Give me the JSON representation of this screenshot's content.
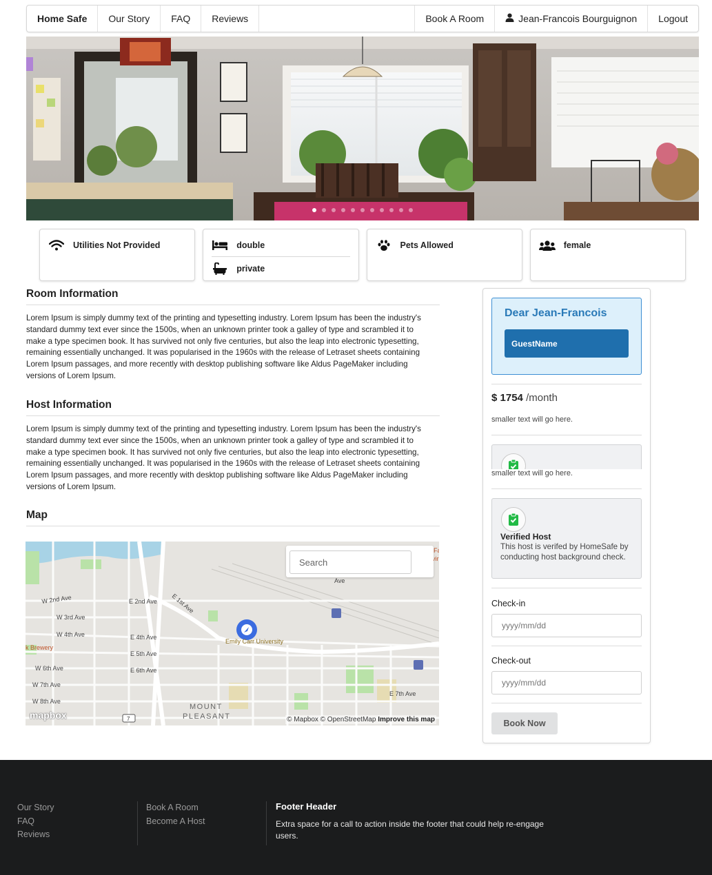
{
  "nav": {
    "brand": "Home Safe",
    "left_items": [
      "Our Story",
      "FAQ",
      "Reviews"
    ],
    "book_room": "Book A Room",
    "user_name": "Jean-Francois Bourguignon",
    "logout": "Logout"
  },
  "hero": {
    "slide_count": 11,
    "active_slide": 0
  },
  "features": {
    "utilities": "Utilities Not Provided",
    "bed": "double",
    "bath": "private",
    "pets": "Pets Allowed",
    "gender": "female"
  },
  "room_info": {
    "title": "Room Information",
    "text": "Lorem Ipsum is simply dummy text of the printing and typesetting industry. Lorem Ipsum has been the industry's standard dummy text ever since the 1500s, when an unknown printer took a galley of type and scrambled it to make a type specimen book. It has survived not only five centuries, but also the leap into electronic typesetting, remaining essentially unchanged. It was popularised in the 1960s with the release of Letraset sheets containing Lorem Ipsum passages, and more recently with desktop publishing software like Aldus PageMaker including versions of Lorem Ipsum."
  },
  "host_info": {
    "title": "Host Information",
    "text": "Lorem Ipsum is simply dummy text of the printing and typesetting industry. Lorem Ipsum has been the industry's standard dummy text ever since the 1500s, when an unknown printer took a galley of type and scrambled it to make a type specimen book. It has survived not only five centuries, but also the leap into electronic typesetting, remaining essentially unchanged. It was popularised in the 1960s with the release of Letraset sheets containing Lorem Ipsum passages, and more recently with desktop publishing software like Aldus PageMaker including versions of Lorem Ipsum."
  },
  "map": {
    "title": "Map",
    "search_placeholder": "Search",
    "streets": [
      "W 2nd Ave",
      "E 2nd Ave",
      "E 1st Ave",
      "W 3rd Ave",
      "W 4th Ave",
      "E 4th Ave",
      "E 5th Ave",
      "W 6th Ave",
      "E 6th Ave",
      "W 7th Ave",
      "W 8th Ave",
      "E 7th Ave",
      "Ave"
    ],
    "places": [
      "Emily Carr University",
      "k Brewery",
      "MOUNT",
      "PLEASANT",
      "Fa",
      "vir"
    ],
    "route_shield": "7",
    "logo": "mapbox",
    "attribution": "© Mapbox © OpenStreetMap",
    "improve": "Improve this map"
  },
  "booking": {
    "greeting": "Dear Jean-Francois",
    "guest_name": "GuestName",
    "currency": "$",
    "price": "1754",
    "period": "/month",
    "small_text_1": "smaller text will go here.",
    "small_text_2": "smaller text will go here.",
    "verified_title": "Verified Host",
    "verified_text": "This host is verifed by HomeSafe by conducting host background check.",
    "checkin_label": "Check-in",
    "checkin_placeholder": "yyyy/mm/dd",
    "checkout_label": "Check-out",
    "checkout_placeholder": "yyyy/mm/dd",
    "book_now": "Book Now"
  },
  "footer": {
    "col1": [
      "Our Story",
      "FAQ",
      "Reviews"
    ],
    "col2": [
      "Book A Room",
      "Become A Host"
    ],
    "header": "Footer Header",
    "text": "Extra space for a call to action inside the footer that could help re-engage users."
  },
  "colors": {
    "accent": "#1f6fad",
    "greeting_bg": "#ddf0fb",
    "verified_green": "#21ba45",
    "footer_bg": "#1b1c1d",
    "map_marker": "#3b6ce0"
  }
}
